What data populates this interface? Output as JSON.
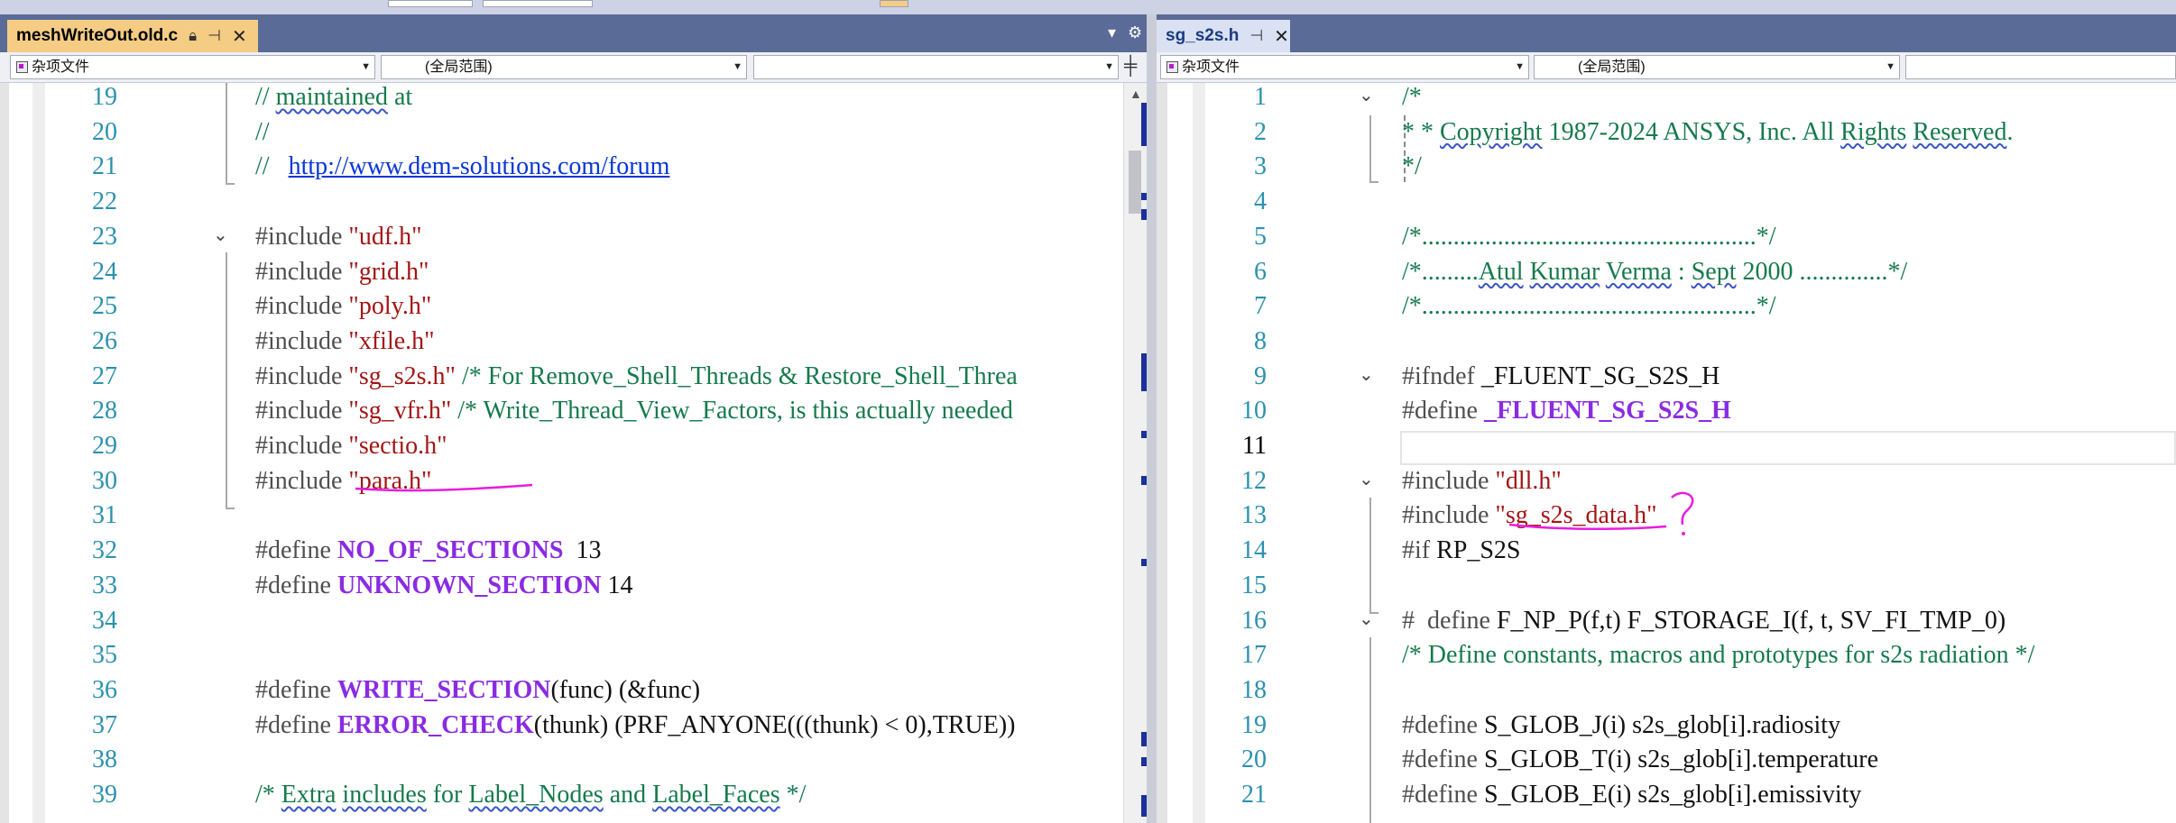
{
  "left_pane": {
    "tab": {
      "title": "meshWriteOut.old.c",
      "pin_icon": "pin-icon",
      "lock_icon": "lock-icon",
      "close_icon": "close-icon"
    },
    "pane_icons": {
      "dropdown": "▾",
      "settings": "⚙"
    },
    "nav": {
      "project": "杂项文件",
      "scope": "(全局范围)",
      "member": ""
    },
    "lines": [
      {
        "num": "19",
        "tokens": [
          {
            "t": "// ",
            "c": "cmt"
          },
          {
            "t": "maintained",
            "c": "cmt sq"
          },
          {
            "t": " at",
            "c": "cmt"
          }
        ]
      },
      {
        "num": "20",
        "tokens": [
          {
            "t": "//",
            "c": "cmt"
          }
        ]
      },
      {
        "num": "21",
        "tokens": [
          {
            "t": "//   ",
            "c": "cmt"
          },
          {
            "t": "http://www.dem-solutions.com/forum",
            "c": "url"
          }
        ]
      },
      {
        "num": "22",
        "tokens": []
      },
      {
        "num": "23",
        "tokens": [
          {
            "t": "#include ",
            "c": "kw"
          },
          {
            "t": "\"udf.h\"",
            "c": "str"
          }
        ]
      },
      {
        "num": "24",
        "tokens": [
          {
            "t": "#include ",
            "c": "kw"
          },
          {
            "t": "\"grid.h\"",
            "c": "str"
          }
        ]
      },
      {
        "num": "25",
        "tokens": [
          {
            "t": "#include ",
            "c": "kw"
          },
          {
            "t": "\"poly.h\"",
            "c": "str"
          }
        ]
      },
      {
        "num": "26",
        "tokens": [
          {
            "t": "#include ",
            "c": "kw"
          },
          {
            "t": "\"xfile.h\"",
            "c": "str"
          }
        ]
      },
      {
        "num": "27",
        "tokens": [
          {
            "t": "#include ",
            "c": "kw"
          },
          {
            "t": "\"sg_s2s.h\"",
            "c": "str"
          },
          {
            "t": " /* For Remove_Shell_Threads & Restore_Shell_Threa",
            "c": "cmt"
          }
        ]
      },
      {
        "num": "28",
        "tokens": [
          {
            "t": "#include ",
            "c": "kw"
          },
          {
            "t": "\"sg_vfr.h\"",
            "c": "str"
          },
          {
            "t": " /* Write_Thread_View_Factors, is this actually needed",
            "c": "cmt"
          }
        ]
      },
      {
        "num": "29",
        "tokens": [
          {
            "t": "#include ",
            "c": "kw"
          },
          {
            "t": "\"sectio.h\"",
            "c": "str"
          }
        ]
      },
      {
        "num": "30",
        "tokens": [
          {
            "t": "#include ",
            "c": "kw"
          },
          {
            "t": "\"para.h\"",
            "c": "str"
          }
        ]
      },
      {
        "num": "31",
        "tokens": []
      },
      {
        "num": "32",
        "tokens": [
          {
            "t": "#define ",
            "c": "kw"
          },
          {
            "t": "NO_OF_SECTIONS",
            "c": "mac"
          },
          {
            "t": "  13",
            "c": "plain"
          }
        ]
      },
      {
        "num": "33",
        "tokens": [
          {
            "t": "#define ",
            "c": "kw"
          },
          {
            "t": "UNKNOWN_SECTION",
            "c": "mac"
          },
          {
            "t": " 14",
            "c": "plain"
          }
        ]
      },
      {
        "num": "34",
        "tokens": []
      },
      {
        "num": "35",
        "tokens": []
      },
      {
        "num": "36",
        "tokens": [
          {
            "t": "#define ",
            "c": "kw"
          },
          {
            "t": "WRITE_SECTION",
            "c": "mac"
          },
          {
            "t": "(func) (&func)",
            "c": "plain"
          }
        ]
      },
      {
        "num": "37",
        "tokens": [
          {
            "t": "#define ",
            "c": "kw"
          },
          {
            "t": "ERROR_CHECK",
            "c": "mac"
          },
          {
            "t": "(thunk) (PRF_ANYONE(((thunk) < 0),TRUE))",
            "c": "plain"
          }
        ]
      },
      {
        "num": "38",
        "tokens": []
      },
      {
        "num": "39",
        "tokens": [
          {
            "t": "/* ",
            "c": "cmt"
          },
          {
            "t": "Extra",
            "c": "cmt sq"
          },
          {
            "t": " ",
            "c": "cmt"
          },
          {
            "t": "includes",
            "c": "cmt sq"
          },
          {
            "t": " for ",
            "c": "cmt"
          },
          {
            "t": "Label_Nodes",
            "c": "cmt sq"
          },
          {
            "t": " and ",
            "c": "cmt"
          },
          {
            "t": "Label_Faces",
            "c": "cmt sq"
          },
          {
            "t": " */",
            "c": "cmt"
          }
        ]
      }
    ]
  },
  "right_pane": {
    "tab": {
      "title": "sg_s2s.h",
      "pin_icon": "pin-icon",
      "close_icon": "close-icon"
    },
    "nav": {
      "project": "杂项文件",
      "scope": "(全局范围)",
      "member": ""
    },
    "lines": [
      {
        "num": "1",
        "tokens": [
          {
            "t": "/*",
            "c": "cmt"
          }
        ]
      },
      {
        "num": "2",
        "tokens": [
          {
            "t": "* * ",
            "c": "cmt"
          },
          {
            "t": "Copyright",
            "c": "cmt sq"
          },
          {
            "t": " 1987-2024 ANSYS, Inc. All ",
            "c": "cmt"
          },
          {
            "t": "Rights",
            "c": "cmt sq"
          },
          {
            "t": " ",
            "c": "cmt"
          },
          {
            "t": "Reserved",
            "c": "cmt sq"
          },
          {
            "t": ".",
            "c": "cmt"
          }
        ]
      },
      {
        "num": "3",
        "tokens": [
          {
            "t": "*/",
            "c": "cmt"
          }
        ]
      },
      {
        "num": "4",
        "tokens": []
      },
      {
        "num": "5",
        "tokens": [
          {
            "t": "/*.....................................................*/",
            "c": "cmt"
          }
        ]
      },
      {
        "num": "6",
        "tokens": [
          {
            "t": "/*.........",
            "c": "cmt"
          },
          {
            "t": "Atul",
            "c": "cmt sq"
          },
          {
            "t": " ",
            "c": "cmt"
          },
          {
            "t": "Kumar",
            "c": "cmt sq"
          },
          {
            "t": " ",
            "c": "cmt"
          },
          {
            "t": "Verma",
            "c": "cmt sq"
          },
          {
            "t": " : ",
            "c": "cmt"
          },
          {
            "t": "Sept",
            "c": "cmt sq"
          },
          {
            "t": " 2000 ..............*/",
            "c": "cmt"
          }
        ]
      },
      {
        "num": "7",
        "tokens": [
          {
            "t": "/*.....................................................*/",
            "c": "cmt"
          }
        ]
      },
      {
        "num": "8",
        "tokens": []
      },
      {
        "num": "9",
        "tokens": [
          {
            "t": "#ifndef ",
            "c": "kw"
          },
          {
            "t": "_FLUENT_SG_S2S_H",
            "c": "plain"
          }
        ]
      },
      {
        "num": "10",
        "tokens": [
          {
            "t": "#define ",
            "c": "kw"
          },
          {
            "t": "_FLUENT_SG_S2S_H",
            "c": "mac"
          }
        ]
      },
      {
        "num": "11",
        "tokens": []
      },
      {
        "num": "12",
        "tokens": [
          {
            "t": "#include ",
            "c": "kw"
          },
          {
            "t": "\"dll.h\"",
            "c": "str"
          }
        ]
      },
      {
        "num": "13",
        "tokens": [
          {
            "t": "#include ",
            "c": "kw"
          },
          {
            "t": "\"sg_s2s_data.h\"",
            "c": "str"
          }
        ]
      },
      {
        "num": "14",
        "tokens": [
          {
            "t": "#if ",
            "c": "kw"
          },
          {
            "t": "RP_S2S",
            "c": "plain"
          }
        ]
      },
      {
        "num": "15",
        "tokens": []
      },
      {
        "num": "16",
        "tokens": [
          {
            "t": "#  define ",
            "c": "kw"
          },
          {
            "t": "F_NP_P(f,t) F_STORAGE_I(f, t, SV_FI_TMP_0)",
            "c": "plain"
          }
        ]
      },
      {
        "num": "17",
        "tokens": [
          {
            "t": "/* Define constants, macros and prototypes for s2s radiation */",
            "c": "cmt"
          }
        ]
      },
      {
        "num": "18",
        "tokens": []
      },
      {
        "num": "19",
        "tokens": [
          {
            "t": "#define ",
            "c": "kw"
          },
          {
            "t": "S_GLOB_J(i) s2s_glob[i].radiosity",
            "c": "plain"
          }
        ]
      },
      {
        "num": "20",
        "tokens": [
          {
            "t": "#define ",
            "c": "kw"
          },
          {
            "t": "S_GLOB_T(i) s2s_glob[i].temperature",
            "c": "plain"
          }
        ]
      },
      {
        "num": "21",
        "tokens": [
          {
            "t": "#define ",
            "c": "kw"
          },
          {
            "t": "S_GLOB_E(i) s2s_glob[i].emissivity",
            "c": "plain"
          }
        ]
      }
    ],
    "current_line": "11"
  },
  "colors": {
    "comment": "#157a4c",
    "string": "#a31515",
    "macro": "#8a2be2",
    "line_number": "#2b91af",
    "active_tab": "#f5cc84",
    "annotation": "#e81ce0"
  }
}
